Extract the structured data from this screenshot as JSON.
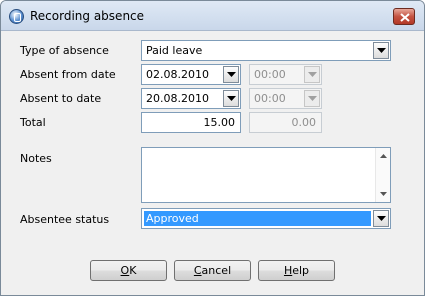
{
  "window": {
    "title": "Recording absence"
  },
  "form": {
    "type_label": "Type of absence",
    "type_value": "Paid leave",
    "from_label": "Absent from date",
    "from_date": "02.08.2010",
    "from_time": "00:00",
    "to_label": "Absent to date",
    "to_date": "20.08.2010",
    "to_time": "00:00",
    "total_label": "Total",
    "total_days": "15.00",
    "total_hours": "0.00",
    "notes_label": "Notes",
    "notes_value": "",
    "status_label": "Absentee status",
    "status_value": "Approved"
  },
  "buttons": {
    "ok_mnemonic": "O",
    "ok_rest": "K",
    "cancel_mnemonic": "C",
    "cancel_rest": "ancel",
    "help_mnemonic": "H",
    "help_rest": "elp"
  },
  "colors": {
    "selection": "#3399ff",
    "title_bar": "#d4e0ee"
  }
}
